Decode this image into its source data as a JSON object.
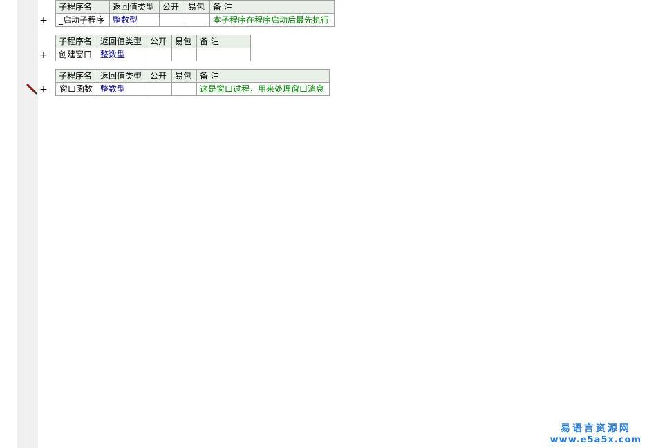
{
  "headers": {
    "name": "子程序名",
    "return_type": "返回值类型",
    "public": "公开",
    "easy_pack": "易包",
    "note": "备 注"
  },
  "expand_symbol": "+",
  "subroutines": [
    {
      "name": "_启动子程序",
      "return_type": "整数型",
      "public": "",
      "easy_pack": "",
      "note": "本子程序在程序启动后最先执行"
    },
    {
      "name": "创建窗口",
      "return_type": "整数型",
      "public": "",
      "easy_pack": "",
      "note": ""
    },
    {
      "name": "窗口函数",
      "return_type": "整数型",
      "public": "",
      "easy_pack": "",
      "note": "这是窗口过程，用来处理窗口消息"
    }
  ],
  "watermark": {
    "cn": "易语言资源网",
    "en": "www.e5a5x.com"
  },
  "colors": {
    "header_bg": "#e8f0e8",
    "return_type": "#000080",
    "note": "#008000",
    "watermark": "#2a7bd4"
  }
}
